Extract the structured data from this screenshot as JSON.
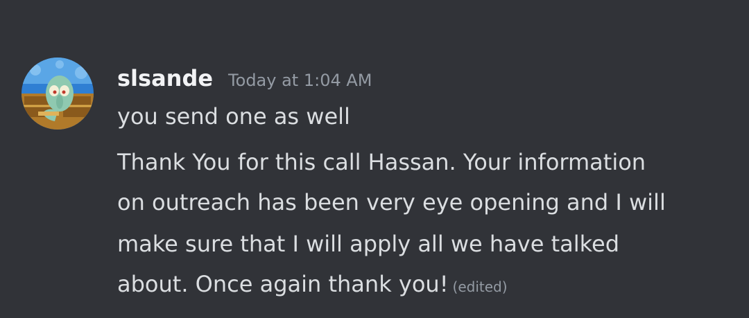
{
  "message": {
    "author": "slsande",
    "timestamp": "Today at 1:04 AM",
    "lines": [
      "you send one as well",
      "Thank You for this call Hassan. Your information",
      "on outreach has been very eye opening and I will",
      "make sure that I will apply all we have talked",
      "about. Once again thank you!"
    ],
    "edited_label": "(edited)"
  },
  "avatar": {
    "icon": "squidward-avatar-icon"
  },
  "colors": {
    "background": "#313338",
    "username": "#f2f3f5",
    "text": "#dbdee1",
    "muted": "#949ba4"
  }
}
